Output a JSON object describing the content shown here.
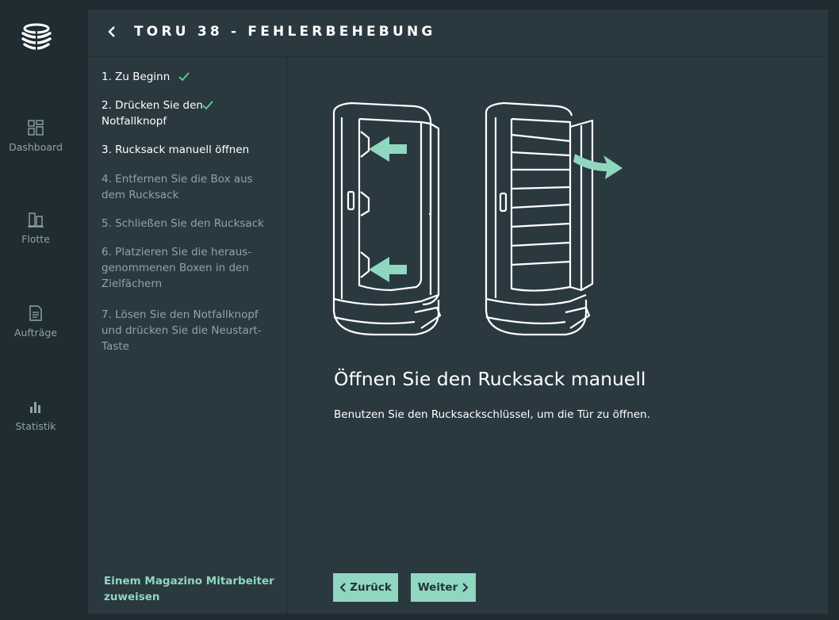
{
  "nav": {
    "items": [
      {
        "label": "Dashboard",
        "icon": "dashboard-icon"
      },
      {
        "label": "Flotte",
        "icon": "fleet-icon"
      },
      {
        "label": "Aufträge",
        "icon": "document-icon"
      },
      {
        "label": "Statistik",
        "icon": "bar-chart-icon"
      }
    ]
  },
  "header": {
    "title": "TORU 38 - FEHLERBEHEBUNG"
  },
  "steps": [
    {
      "label": "1. Zu Beginn",
      "state": "done"
    },
    {
      "label": "2. Drücken Sie den Notfallknopf",
      "state": "done"
    },
    {
      "label": "3. Rucksack manuell öffnen",
      "state": "current"
    },
    {
      "label": "4. Entfernen Sie die Box aus dem Rucksack",
      "state": "todo"
    },
    {
      "label": "5. Schließen Sie den Rucksack",
      "state": "todo"
    },
    {
      "label": "6. Platzieren Sie die heraus- genommenen Boxen in den Zielfächern",
      "state": "todo"
    },
    {
      "label": "7. Lösen Sie den Notfallknopf und drücken Sie die Neustart- Taste",
      "state": "todo"
    }
  ],
  "assign_link": "Einem Magazino Mitarbeiter zuweisen",
  "content": {
    "title": "Öffnen Sie den Rucksack manuell",
    "description": "Benutzen Sie den Rucksackschlüssel, um die Tür zu öffnen."
  },
  "buttons": {
    "back": "Zurück",
    "next": "Weiter"
  },
  "colors": {
    "accent": "#8fd7c0",
    "panel": "#2a393f",
    "rail": "#1f2c31",
    "muted_text": "#8fa3a9"
  }
}
